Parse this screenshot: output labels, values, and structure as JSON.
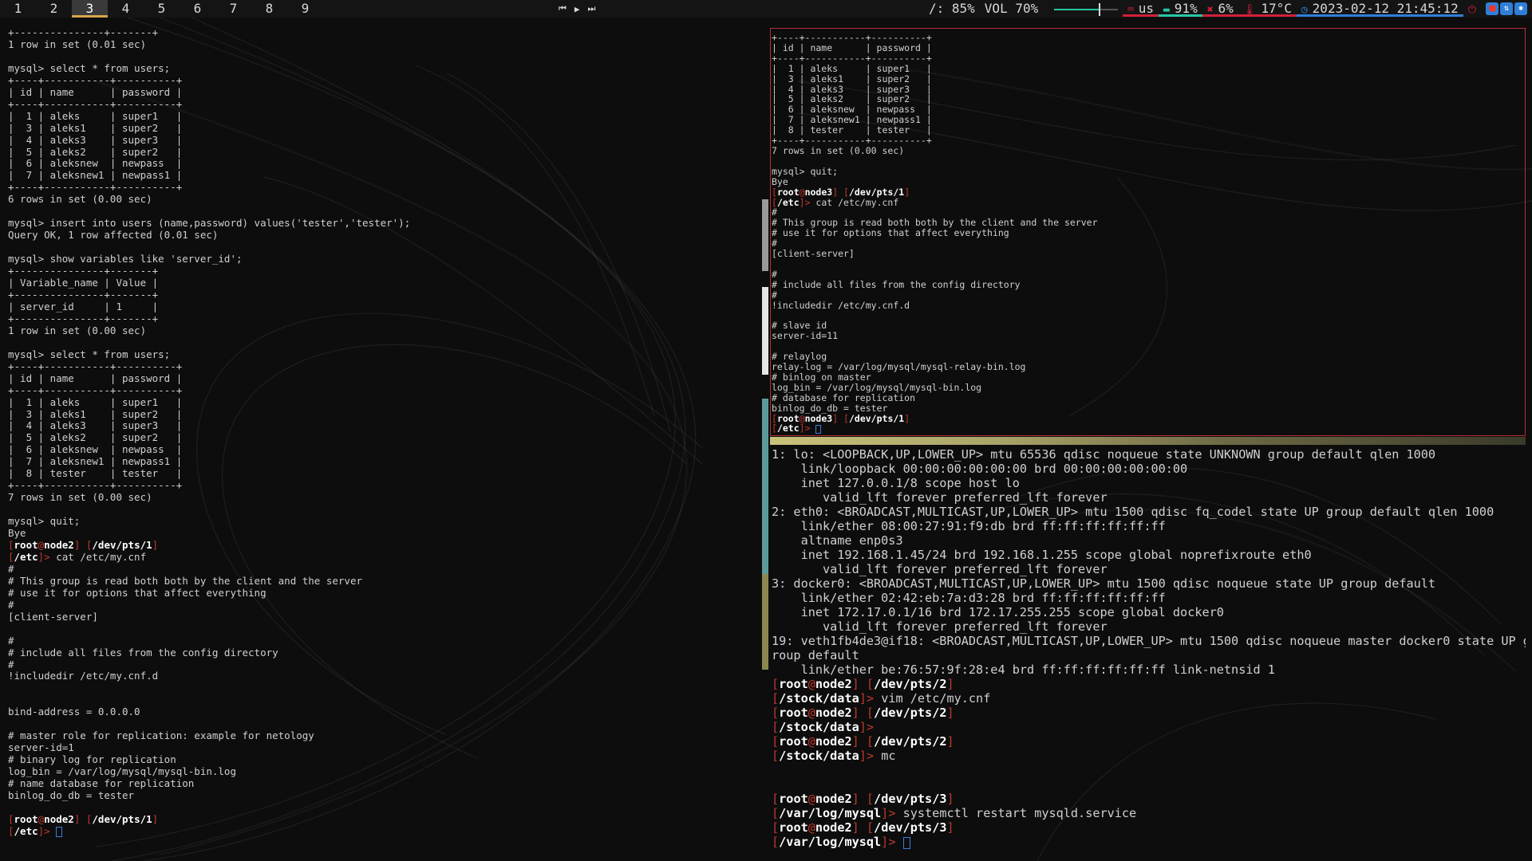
{
  "topbar": {
    "workspaces": [
      {
        "label": "1",
        "active": false
      },
      {
        "label": "2",
        "active": false
      },
      {
        "label": "3",
        "active": true
      },
      {
        "label": "4",
        "active": false
      },
      {
        "label": "5",
        "active": false
      },
      {
        "label": "6",
        "active": false
      },
      {
        "label": "7",
        "active": false
      },
      {
        "label": "8",
        "active": false
      },
      {
        "label": "9",
        "active": false
      }
    ],
    "media": {
      "prev_icon": "⏮",
      "play_icon": "▶",
      "next_icon": "⏭"
    },
    "disk": "/: 85%",
    "volume": {
      "label": "VOL 70%",
      "value": 70
    },
    "keyboard_layout": "us",
    "battery": "91%",
    "cpu": "6%",
    "temperature": "17°C",
    "datetime": "2023-02-12 21:45:12",
    "colors": {
      "accent": "#d7a44a",
      "red": "#d0203a",
      "teal": "#27c6a4",
      "blue": "#2f7fd8",
      "prompt_bracket": "#c0392b"
    }
  },
  "terminal_left": {
    "lines": [
      "+---------------+-------+",
      "1 row in set (0.01 sec)",
      "",
      "mysql> select * from users;",
      "+----+-----------+----------+",
      "| id | name      | password |",
      "+----+-----------+----------+",
      "|  1 | aleks     | super1   |",
      "|  3 | aleks1    | super2   |",
      "|  4 | aleks3    | super3   |",
      "|  5 | aleks2    | super2   |",
      "|  6 | aleksnew  | newpass  |",
      "|  7 | aleksnew1 | newpass1 |",
      "+----+-----------+----------+",
      "6 rows in set (0.00 sec)",
      "",
      "mysql> insert into users (name,password) values('tester','tester');",
      "Query OK, 1 row affected (0.01 sec)",
      "",
      "mysql> show variables like 'server_id';",
      "+---------------+-------+",
      "| Variable_name | Value |",
      "+---------------+-------+",
      "| server_id     | 1     |",
      "+---------------+-------+",
      "1 row in set (0.00 sec)",
      "",
      "mysql> select * from users;",
      "+----+-----------+----------+",
      "| id | name      | password |",
      "+----+-----------+----------+",
      "|  1 | aleks     | super1   |",
      "|  3 | aleks1    | super2   |",
      "|  4 | aleks3    | super3   |",
      "|  5 | aleks2    | super2   |",
      "|  6 | aleksnew  | newpass  |",
      "|  7 | aleksnew1 | newpass1 |",
      "|  8 | tester    | tester   |",
      "+----+-----------+----------+",
      "7 rows in set (0.00 sec)",
      "",
      "mysql> quit;",
      "Bye",
      "[root@node2] [/dev/pts/1]",
      "[/etc]> cat /etc/my.cnf",
      "#",
      "# This group is read both both by the client and the server",
      "# use it for options that affect everything",
      "#",
      "[client-server]",
      "",
      "#",
      "# include all files from the config directory",
      "#",
      "!includedir /etc/my.cnf.d",
      "",
      "",
      "bind-address = 0.0.0.0",
      "",
      "# master role for replication: example for netology",
      "server-id=1",
      "# binary log for replication",
      "log_bin = /var/log/mysql/mysql-bin.log",
      "# name database for replication",
      "binlog_do_db = tester",
      "",
      "[root@node2] [/dev/pts/1]",
      "[/etc]> "
    ]
  },
  "terminal_top_right": {
    "lines": [
      "+----+-----------+----------+",
      "| id | name      | password |",
      "+----+-----------+----------+",
      "|  1 | aleks     | super1   |",
      "|  3 | aleks1    | super2   |",
      "|  4 | aleks3    | super3   |",
      "|  5 | aleks2    | super2   |",
      "|  6 | aleksnew  | newpass  |",
      "|  7 | aleksnew1 | newpass1 |",
      "|  8 | tester    | tester   |",
      "+----+-----------+----------+",
      "7 rows in set (0.00 sec)",
      "",
      "mysql> quit;",
      "Bye",
      "[root@node3] [/dev/pts/1]",
      "[/etc]> cat /etc/my.cnf",
      "#",
      "# This group is read both both by the client and the server",
      "# use it for options that affect everything",
      "#",
      "[client-server]",
      "",
      "#",
      "# include all files from the config directory",
      "#",
      "!includedir /etc/my.cnf.d",
      "",
      "# slave id",
      "server-id=11",
      "",
      "# relaylog",
      "relay-log = /var/log/mysql/mysql-relay-bin.log",
      "# binlog on master",
      "log_bin = /var/log/mysql/mysql-bin.log",
      "# database for replication",
      "binlog_do_db = tester",
      "[root@node3] [/dev/pts/1]",
      "[/etc]> "
    ]
  },
  "terminal_bottom_right": {
    "lines": [
      "1: lo: <LOOPBACK,UP,LOWER_UP> mtu 65536 qdisc noqueue state UNKNOWN group default qlen 1000",
      "    link/loopback 00:00:00:00:00:00 brd 00:00:00:00:00:00",
      "    inet 127.0.0.1/8 scope host lo",
      "       valid_lft forever preferred_lft forever",
      "2: eth0: <BROADCAST,MULTICAST,UP,LOWER_UP> mtu 1500 qdisc fq_codel state UP group default qlen 1000",
      "    link/ether 08:00:27:91:f9:db brd ff:ff:ff:ff:ff:ff",
      "    altname enp0s3",
      "    inet 192.168.1.45/24 brd 192.168.1.255 scope global noprefixroute eth0",
      "       valid_lft forever preferred_lft forever",
      "3: docker0: <BROADCAST,MULTICAST,UP,LOWER_UP> mtu 1500 qdisc noqueue state UP group default",
      "    link/ether 02:42:eb:7a:d3:28 brd ff:ff:ff:ff:ff:ff",
      "    inet 172.17.0.1/16 brd 172.17.255.255 scope global docker0",
      "       valid_lft forever preferred_lft forever",
      "19: veth1fb4de3@if18: <BROADCAST,MULTICAST,UP,LOWER_UP> mtu 1500 qdisc noqueue master docker0 state UP g",
      "roup default",
      "    link/ether be:76:57:9f:28:e4 brd ff:ff:ff:ff:ff:ff link-netnsid 1",
      "[root@node2] [/dev/pts/2]",
      "[/stock/data]> vim /etc/my.cnf",
      "[root@node2] [/dev/pts/2]",
      "[/stock/data]> ",
      "[root@node2] [/dev/pts/2]",
      "[/stock/data]> mc",
      "",
      "",
      "[root@node2] [/dev/pts/3]",
      "[/var/log/mysql]> systemctl restart mysqld.service",
      "[root@node2] [/dev/pts/3]",
      "[/var/log/mysql]> "
    ]
  }
}
